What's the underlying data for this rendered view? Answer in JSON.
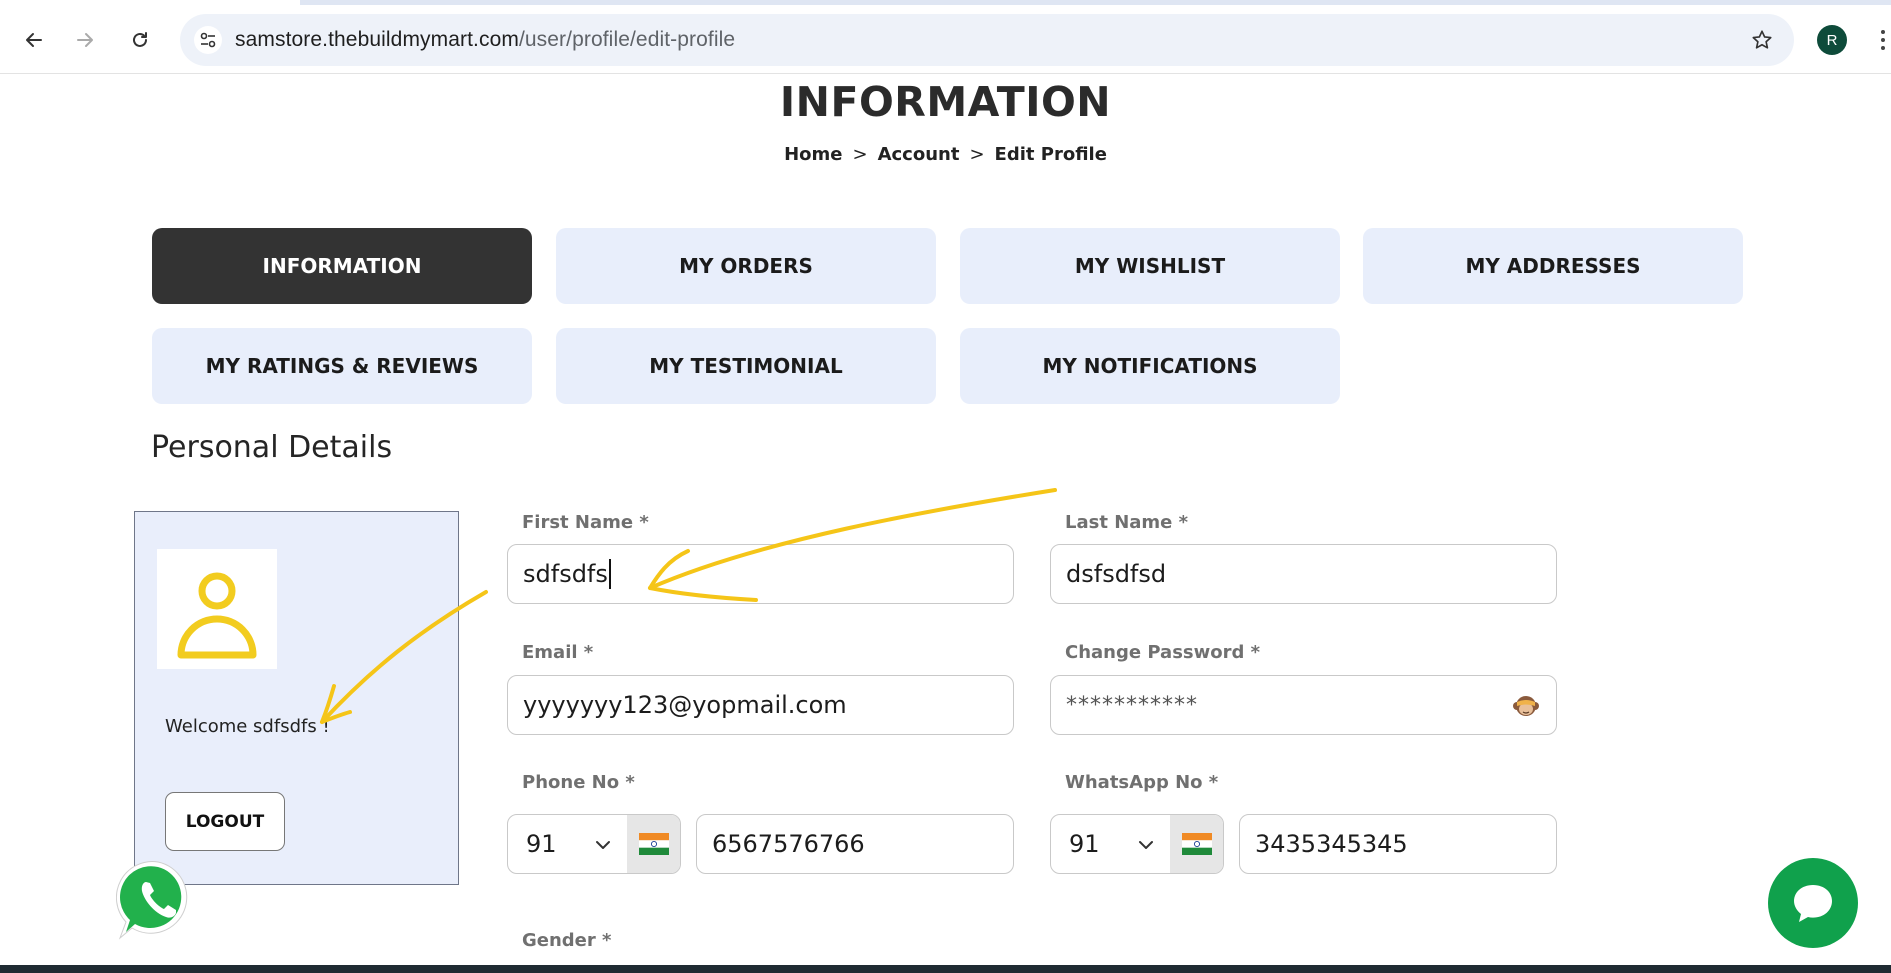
{
  "browser": {
    "url_host": "samstore.thebuildmymart.com",
    "url_path": "/user/profile/edit-profile",
    "profile_initial": "R"
  },
  "page": {
    "title": "INFORMATION",
    "breadcrumb": [
      "Home",
      "Account",
      "Edit Profile"
    ],
    "breadcrumb_sep": ">"
  },
  "tabs": [
    {
      "label": "INFORMATION",
      "active": true
    },
    {
      "label": "MY ORDERS"
    },
    {
      "label": "MY WISHLIST"
    },
    {
      "label": "MY ADDRESSES"
    },
    {
      "label": "MY RATINGS & REVIEWS"
    },
    {
      "label": "MY TESTIMONIAL"
    },
    {
      "label": "MY NOTIFICATIONS"
    }
  ],
  "section_title": "Personal Details",
  "profile_card": {
    "welcome": "Welcome sdfsdfs !",
    "logout_label": "LOGOUT"
  },
  "form": {
    "first_name": {
      "label": "First Name *",
      "value": "sdfsdfs"
    },
    "last_name": {
      "label": "Last Name *",
      "value": "dsfsdfsd"
    },
    "email": {
      "label": "Email *",
      "value": "yyyyyyy123@yopmail.com"
    },
    "password": {
      "label": "Change Password *",
      "value": "***********"
    },
    "phone": {
      "label": "Phone No *",
      "code": "91",
      "value": "6567576766"
    },
    "whatsapp": {
      "label": "WhatsApp No *",
      "code": "91",
      "value": "3435345345"
    },
    "gender": {
      "label": "Gender *"
    }
  },
  "colors": {
    "active_tab": "#333333",
    "tab_bg": "#e8eefb",
    "annotation": "#f5c518",
    "chat_button": "#10a14c"
  },
  "icons": [
    "back-arrow-icon",
    "forward-arrow-icon",
    "reload-icon",
    "site-settings-icon",
    "star-icon",
    "user-avatar-icon",
    "india-flag-icon",
    "chevron-down-icon",
    "monkey-eye-icon",
    "whatsapp-icon",
    "chat-icon"
  ]
}
